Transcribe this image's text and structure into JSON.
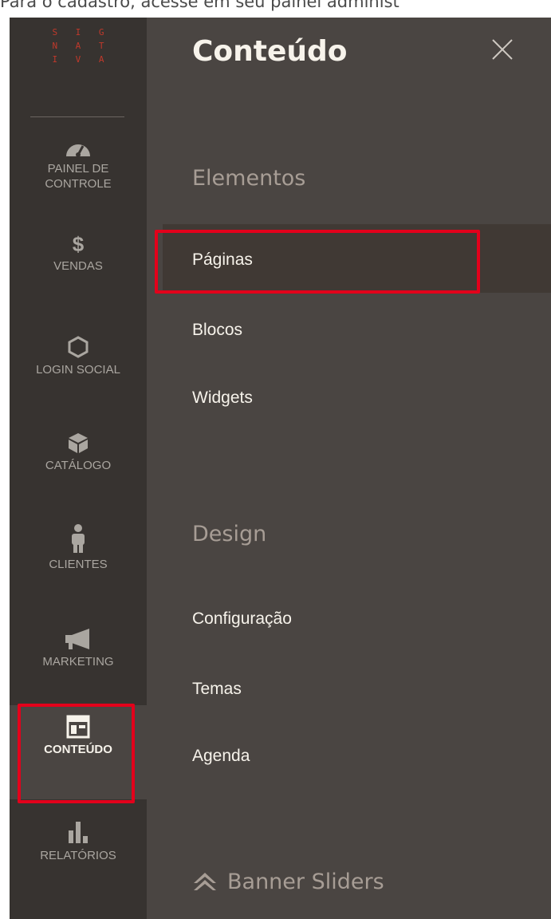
{
  "caption": "Para o cadastro, acesse em seu painel administ",
  "logo": {
    "lines": [
      "S I G",
      "N A T",
      "I V A"
    ]
  },
  "nav": {
    "items": [
      {
        "id": "dashboard",
        "label_line1": "PAINEL DE",
        "label_line2": "CONTROLE",
        "icon": "dashboard-gauge-icon"
      },
      {
        "id": "sales",
        "label": "VENDAS",
        "icon": "dollar-icon"
      },
      {
        "id": "social-login",
        "label": "LOGIN SOCIAL",
        "icon": "hexagon-icon"
      },
      {
        "id": "catalog",
        "label": "CATÁLOGO",
        "icon": "box-icon"
      },
      {
        "id": "customers",
        "label": "CLIENTES",
        "icon": "person-icon"
      },
      {
        "id": "marketing",
        "label": "MARKETING",
        "icon": "megaphone-icon"
      },
      {
        "id": "content",
        "label": "CONTEÚDO",
        "icon": "layout-icon",
        "active": true
      },
      {
        "id": "reports",
        "label": "RELATÓRIOS",
        "icon": "bar-chart-icon"
      }
    ]
  },
  "flyout": {
    "title": "Conteúdo",
    "close_icon": "close-icon",
    "sections": [
      {
        "title": "Elementos",
        "links": [
          "Páginas",
          "Blocos",
          "Widgets"
        ]
      },
      {
        "title": "Design",
        "links": [
          "Configuração",
          "Temas",
          "Agenda"
        ]
      }
    ],
    "banner_sliders": "Banner Sliders"
  },
  "colors": {
    "nav_bg": "#373330",
    "flyout_bg": "#4a4542",
    "highlight": "#e3001b",
    "logo": "#c0392b"
  }
}
